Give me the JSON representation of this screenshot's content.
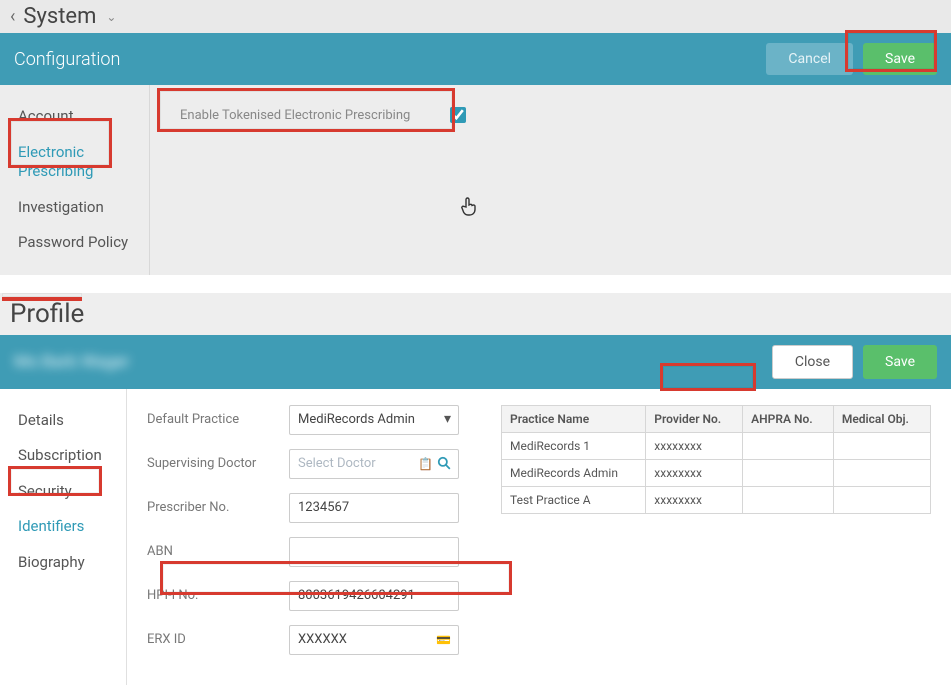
{
  "breadcrumb": {
    "title": "System"
  },
  "config": {
    "panel_title": "Configuration",
    "cancel": "Cancel",
    "save": "Save",
    "sidebar": [
      "Account",
      "Electronic Prescribing",
      "Investigation",
      "Password Policy"
    ],
    "active_index": 1,
    "checkbox_label": "Enable Tokenised Electronic Prescribing",
    "checkbox_checked": true
  },
  "profile": {
    "heading": "Profile",
    "name": "Ms Barb Wager",
    "close": "Close",
    "save": "Save",
    "sidebar": [
      "Details",
      "Subscription",
      "Security",
      "Identifiers",
      "Biography"
    ],
    "active_index": 3,
    "fields": {
      "default_practice_label": "Default Practice",
      "default_practice_value": "MediRecords Admin",
      "supervising_doctor_label": "Supervising Doctor",
      "supervising_doctor_placeholder": "Select Doctor",
      "prescriber_no_label": "Prescriber No.",
      "prescriber_no_value": "1234567",
      "abn_label": "ABN",
      "abn_value": "",
      "hpii_label": "HPI-I No.",
      "hpii_value": "8003619426604291",
      "erx_label": "ERX ID",
      "erx_value": "XXXXXX"
    },
    "table": {
      "headers": [
        "Practice Name",
        "Provider No.",
        "AHPRA No.",
        "Medical Obj."
      ],
      "rows": [
        {
          "practice": "MediRecords 1",
          "provider": "xxxxxxxx",
          "ahpra": "",
          "medobj": ""
        },
        {
          "practice": "MediRecords Admin",
          "provider": "xxxxxxxx",
          "ahpra": "",
          "medobj": ""
        },
        {
          "practice": "Test Practice A",
          "provider": "xxxxxxxx",
          "ahpra": "",
          "medobj": ""
        }
      ]
    }
  }
}
